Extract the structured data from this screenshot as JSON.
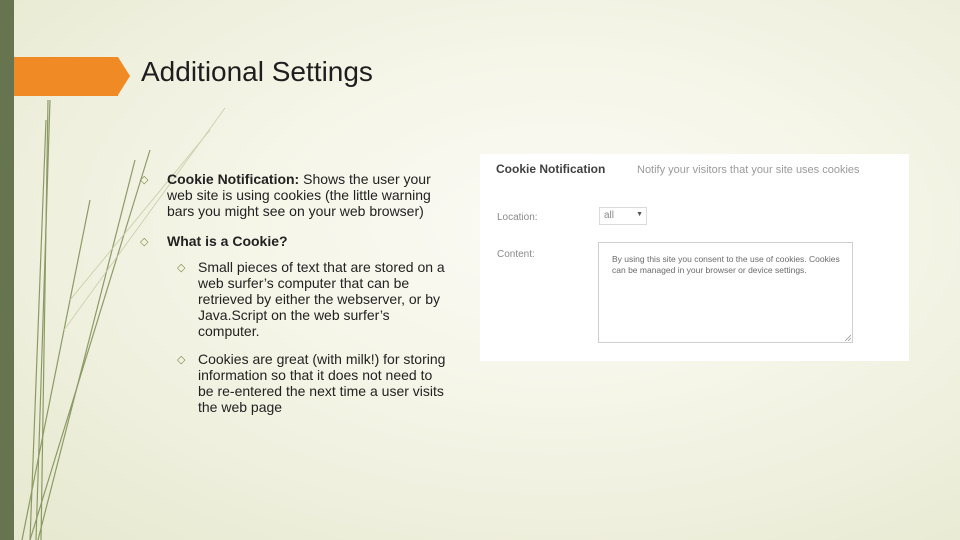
{
  "slide": {
    "title": "Additional Settings"
  },
  "bullets": {
    "cookie_notification": {
      "label": "Cookie Notification:",
      "text": " Shows the user your web site is using cookies (the little warning bars you might see on your web browser)"
    },
    "what_is_cookie": {
      "label": "What is a Cookie?"
    },
    "sub": [
      {
        "text": "Small pieces of text that are stored on a web surfer’s computer that can be retrieved by either the webserver, or by Java.Script on the web surfer’s computer."
      },
      {
        "text": "Cookies are great (with milk!) for storing information so that it does not need to be re-entered the next time a user visits the web page"
      }
    ]
  },
  "screenshot_panel": {
    "heading": "Cookie Notification",
    "description": "Notify your visitors that your site uses cookies",
    "location_label": "Location:",
    "location_value": "all",
    "content_label": "Content:",
    "content_value": "By using this site you consent to the use of cookies. Cookies can be managed in your browser or device settings."
  },
  "colors": {
    "accent_orange": "#f08a24",
    "side_bar_green": "#66744f",
    "bullet_green": "#7e8f43"
  },
  "icons": {
    "bullet": "diamond-bullet-icon",
    "dropdown": "chevron-down-icon",
    "resize": "resize-handle-icon"
  }
}
